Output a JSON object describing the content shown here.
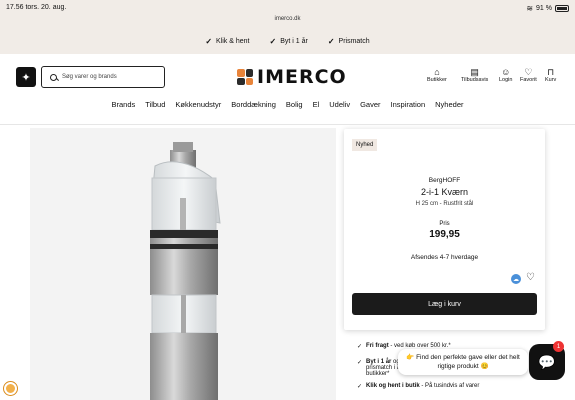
{
  "status": {
    "time": "17.56  tors. 20. aug.",
    "url": "imerco.dk",
    "battery": "91 %"
  },
  "promo": [
    {
      "label": "Klik & hent"
    },
    {
      "label": "Byt i 1 år"
    },
    {
      "label": "Prismatch"
    }
  ],
  "header": {
    "search_placeholder": "Søg varer og brands",
    "logo_text": "IMERCO",
    "utilities": [
      {
        "label": "Butikker",
        "icon": "store-icon"
      },
      {
        "label": "Tilbudsavis",
        "icon": "flyer-icon"
      },
      {
        "label": "Login",
        "icon": "user-icon"
      },
      {
        "label": "Favorit",
        "icon": "heart-icon"
      },
      {
        "label": "Kurv",
        "icon": "bag-icon"
      }
    ]
  },
  "nav": [
    "Brands",
    "Tilbud",
    "Køkkenudstyr",
    "Borddækning",
    "Bolig",
    "El",
    "Udeliv",
    "Gaver",
    "Inspiration",
    "Nyheder"
  ],
  "product": {
    "badge": "Nyhed",
    "brand": "BergHOFF",
    "title": "2-i-1 Kværn",
    "subtitle": "H 25 cm - Rustfrit stål",
    "price_label": "Pris",
    "price": "199,95",
    "delivery": "Afsendes 4-7 hverdage",
    "cart_button": "Læg i kurv"
  },
  "usps": [
    {
      "bold": "Fri fragt",
      "text": " - ved køb over 500 kr.*"
    },
    {
      "bold": "Byt i 1 år",
      "text": " og prismatch i alle butikker*"
    },
    {
      "bold": "Klik og hent i butik",
      "text": " - På tusindvis af varer"
    }
  ],
  "chat": {
    "message": "👉 Find den perfekte gave eller det helt rigtige produkt 😊",
    "count": "1"
  },
  "colors": {
    "cream": "#f1ece7",
    "dark": "#1b1b1b",
    "accent_blue": "#4a90d9"
  }
}
